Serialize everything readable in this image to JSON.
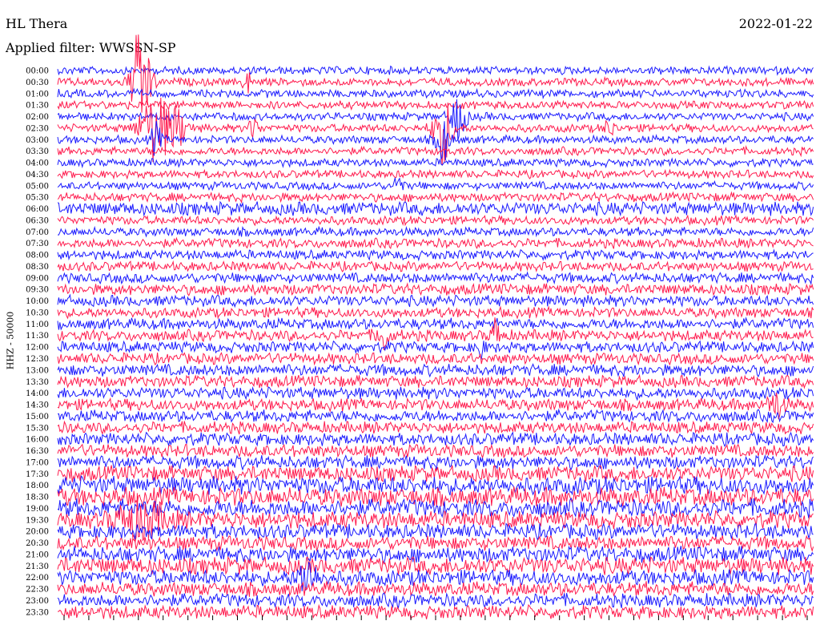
{
  "header": {
    "station": "HL Thera",
    "date": "2022-01-22",
    "filter_label": "Applied filter: WWSSN-SP",
    "channel_label": "HHZ - 50000"
  },
  "colors": {
    "trace_a": "#1a1aff",
    "trace_b": "#ff1a4d"
  },
  "chart_data": {
    "type": "helicorder",
    "title": "HL Thera",
    "date": "2022-01-22",
    "filter": "WWSSN-SP",
    "ylabel": "HHZ - 50000",
    "row_labels": [
      "00:00",
      "00:30",
      "01:00",
      "01:30",
      "02:00",
      "02:30",
      "03:00",
      "03:30",
      "04:00",
      "04:30",
      "05:00",
      "05:30",
      "06:00",
      "06:30",
      "07:00",
      "07:30",
      "08:00",
      "08:30",
      "09:00",
      "09:30",
      "10:00",
      "10:30",
      "11:00",
      "11:30",
      "12:00",
      "12:30",
      "13:00",
      "13:30",
      "14:00",
      "14:30",
      "15:00",
      "15:30",
      "16:00",
      "16:30",
      "17:00",
      "17:30",
      "18:00",
      "18:30",
      "19:00",
      "19:30",
      "20:00",
      "20:30",
      "21:00",
      "21:30",
      "22:00",
      "22:30",
      "23:00",
      "23:30"
    ],
    "series_colors_alternate": [
      "blue",
      "red"
    ],
    "rows": [
      {
        "noise": 0.2,
        "bursts": []
      },
      {
        "noise": 0.2,
        "bursts": [
          {
            "x": 0.11,
            "amp": 5,
            "w": 0.012
          },
          {
            "x": 0.25,
            "amp": 1.5,
            "w": 0.004
          }
        ]
      },
      {
        "noise": 0.2,
        "bursts": []
      },
      {
        "noise": 0.2,
        "bursts": []
      },
      {
        "noise": 0.2,
        "bursts": [
          {
            "x": 0.53,
            "amp": 2,
            "w": 0.01
          }
        ]
      },
      {
        "noise": 0.2,
        "bursts": [
          {
            "x": 0.13,
            "amp": 3,
            "w": 0.02
          },
          {
            "x": 0.16,
            "amp": 1.4,
            "w": 0.012
          },
          {
            "x": 0.26,
            "amp": 1,
            "w": 0.006
          },
          {
            "x": 0.51,
            "amp": 3,
            "w": 0.012
          },
          {
            "x": 0.73,
            "amp": 0.8,
            "w": 0.006
          }
        ]
      },
      {
        "noise": 0.2,
        "bursts": [
          {
            "x": 0.13,
            "amp": 1.5,
            "w": 0.006
          },
          {
            "x": 0.51,
            "amp": 2,
            "w": 0.008
          }
        ]
      },
      {
        "noise": 0.2,
        "bursts": []
      },
      {
        "noise": 0.2,
        "bursts": []
      },
      {
        "noise": 0.2,
        "bursts": []
      },
      {
        "noise": 0.2,
        "bursts": [
          {
            "x": 0.45,
            "amp": 1.2,
            "w": 0.005
          }
        ]
      },
      {
        "noise": 0.25,
        "bursts": []
      },
      {
        "noise": 0.55,
        "bursts": []
      },
      {
        "noise": 0.25,
        "bursts": []
      },
      {
        "noise": 0.25,
        "bursts": []
      },
      {
        "noise": 0.3,
        "bursts": []
      },
      {
        "noise": 0.3,
        "bursts": []
      },
      {
        "noise": 0.3,
        "bursts": []
      },
      {
        "noise": 0.35,
        "bursts": []
      },
      {
        "noise": 0.4,
        "bursts": []
      },
      {
        "noise": 0.4,
        "bursts": []
      },
      {
        "noise": 0.35,
        "bursts": []
      },
      {
        "noise": 0.4,
        "bursts": []
      },
      {
        "noise": 0.4,
        "bursts": [
          {
            "x": 0.43,
            "amp": 1.2,
            "w": 0.008
          },
          {
            "x": 0.58,
            "amp": 1.4,
            "w": 0.006
          }
        ]
      },
      {
        "noise": 0.4,
        "bursts": [
          {
            "x": 0.56,
            "amp": 1,
            "w": 0.004
          }
        ]
      },
      {
        "noise": 0.4,
        "bursts": []
      },
      {
        "noise": 0.45,
        "bursts": []
      },
      {
        "noise": 0.45,
        "bursts": []
      },
      {
        "noise": 0.45,
        "bursts": []
      },
      {
        "noise": 0.45,
        "bursts": [
          {
            "x": 0.95,
            "amp": 1.2,
            "w": 0.01
          }
        ]
      },
      {
        "noise": 0.45,
        "bursts": []
      },
      {
        "noise": 0.45,
        "bursts": []
      },
      {
        "noise": 0.5,
        "bursts": []
      },
      {
        "noise": 0.5,
        "bursts": []
      },
      {
        "noise": 0.55,
        "bursts": []
      },
      {
        "noise": 0.7,
        "bursts": []
      },
      {
        "noise": 0.85,
        "bursts": []
      },
      {
        "noise": 0.9,
        "bursts": []
      },
      {
        "noise": 0.85,
        "bursts": []
      },
      {
        "noise": 0.8,
        "bursts": [
          {
            "x": 0.11,
            "amp": 1.6,
            "w": 0.03
          }
        ]
      },
      {
        "noise": 0.65,
        "bursts": []
      },
      {
        "noise": 0.6,
        "bursts": []
      },
      {
        "noise": 0.7,
        "bursts": []
      },
      {
        "noise": 0.8,
        "bursts": []
      },
      {
        "noise": 0.7,
        "bursts": [
          {
            "x": 0.33,
            "amp": 1.6,
            "w": 0.012
          }
        ]
      },
      {
        "noise": 0.6,
        "bursts": []
      },
      {
        "noise": 0.55,
        "bursts": []
      },
      {
        "noise": 0.55,
        "bursts": []
      }
    ]
  }
}
